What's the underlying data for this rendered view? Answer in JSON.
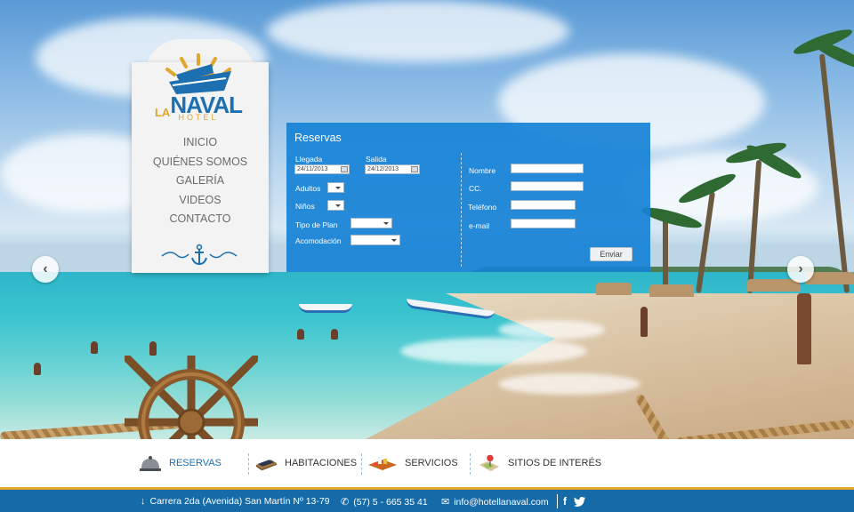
{
  "brand": {
    "logo_la": "LA",
    "logo_naval": "NAVAL",
    "logo_hotel": "HOTEL"
  },
  "menu": {
    "items": [
      {
        "label": "INICIO"
      },
      {
        "label": "QUIÉNES SOMOS"
      },
      {
        "label": "GALERÍA"
      },
      {
        "label": "VIDEOS"
      },
      {
        "label": "CONTACTO"
      }
    ]
  },
  "reservation_form": {
    "title": "Reservas",
    "arrival_label": "Llegada",
    "arrival_value": "24/11/2013",
    "departure_label": "Salida",
    "departure_value": "24/12/2013",
    "adults_label": "Adultos",
    "children_label": "Niños",
    "plan_type_label": "Tipo de Plan",
    "accommodation_label": "Acomodación",
    "name_label": "Nombre",
    "id_label": "CC.",
    "phone_label": "Teléfono",
    "email_label": "e-mail",
    "submit_label": "Enviar"
  },
  "tabs": [
    {
      "label": "RESERVAS",
      "icon": "bell-icon",
      "active": true
    },
    {
      "label": "HABITACIONES",
      "icon": "bed-icon",
      "active": false
    },
    {
      "label": "SERVICIOS",
      "icon": "tray-icon",
      "active": false
    },
    {
      "label": "SITIOS DE INTERÉS",
      "icon": "map-pin-icon",
      "active": false
    }
  ],
  "footer": {
    "address": "Carrera 2da  (Avenida) San Martín Nº 13-79",
    "phone": "(57) 5 - 665 35 41",
    "email": "info@hotellanaval.com",
    "facebook": "f"
  },
  "colors": {
    "brand_blue": "#1c6fb0",
    "form_blue": "#1682d6",
    "accent_gold": "#e3a52b",
    "footer_blue": "#156aa8"
  }
}
